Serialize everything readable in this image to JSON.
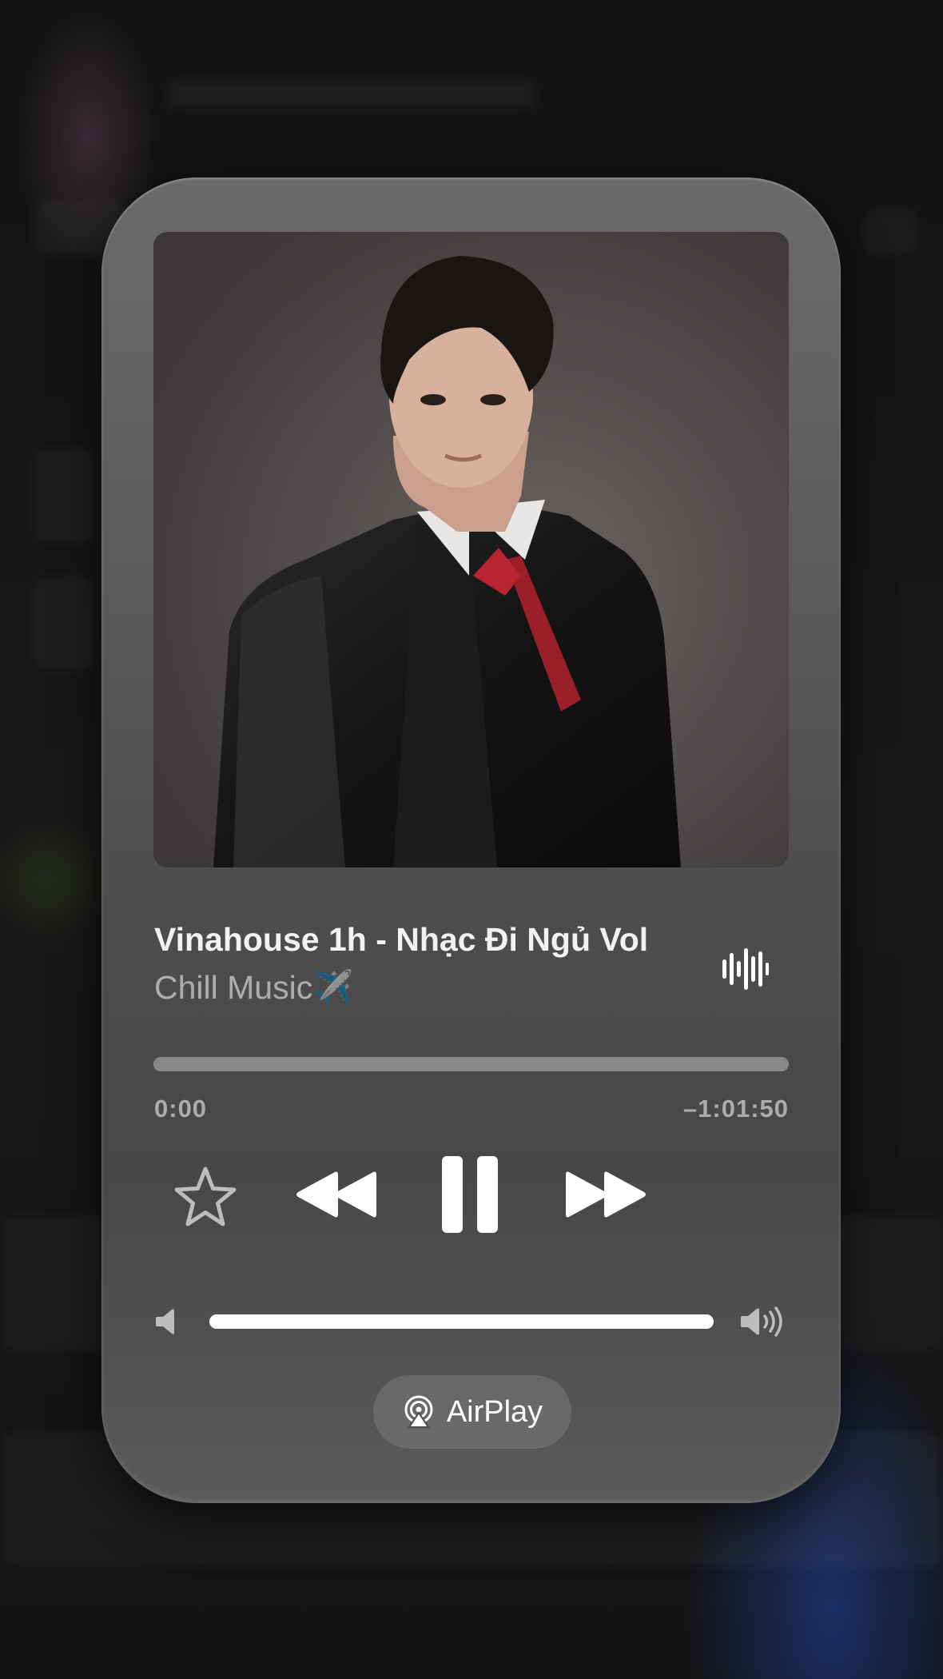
{
  "now_playing": {
    "title": "Vinahouse 1h - Nhạc Đi Ngủ Vol",
    "artist": "Chill Music✈️",
    "artwork_icon": "album-artwork-portrait",
    "elapsed": "0:00",
    "remaining": "–1:01:50",
    "progress_fraction": 0.0,
    "volume_fraction": 1.0
  },
  "controls": {
    "favorite_icon": "star-outline-icon",
    "rewind_icon": "rewind-icon",
    "pause_icon": "pause-icon",
    "forward_icon": "fast-forward-icon",
    "waveform_icon": "waveform-icon",
    "volume_low_icon": "speaker-low-icon",
    "volume_high_icon": "speaker-high-icon"
  },
  "airplay": {
    "label": "AirPlay",
    "icon": "airplay-icon"
  },
  "colors": {
    "card": "#5b5b5b",
    "text_primary": "#f2f2f2",
    "text_secondary": "#9d9d9d",
    "accent_blue": "#1e3c8c"
  }
}
